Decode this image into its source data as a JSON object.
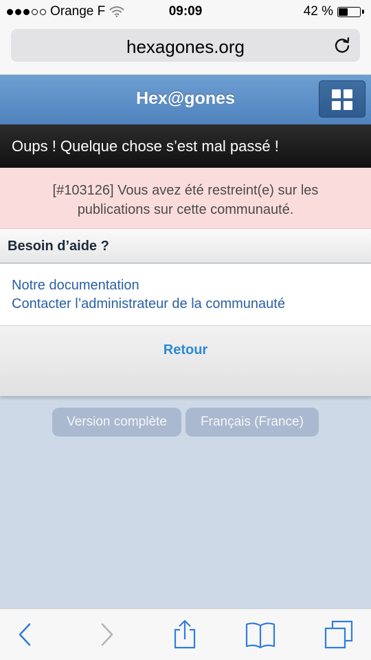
{
  "status": {
    "carrier": "Orange F",
    "time": "09:09",
    "battery_text": "42 %",
    "battery_level": 0.42,
    "signal_bars_filled": 3,
    "signal_bars_total": 5
  },
  "browser": {
    "url": "hexagones.org",
    "reload_icon": "reload-icon"
  },
  "header": {
    "title": "Hex@gones",
    "menu_icon": "grid-icon",
    "accent_color": "#4f83bd"
  },
  "error": {
    "title": "Oups ! Quelque chose s’est mal passé !",
    "message": "[#103126] Vous avez été restreint(e) sur les publications sur cette communauté."
  },
  "help": {
    "title": "Besoin d’aide ?",
    "links": [
      "Notre documentation",
      "Contacter l’administrateur de la communauté"
    ]
  },
  "back_label": "Retour",
  "footer": {
    "version_label": "Version complète",
    "language_label": "Français (France)"
  },
  "toolbar": {
    "icons": [
      "back-icon",
      "forward-icon",
      "share-icon",
      "bookmarks-icon",
      "tabs-icon"
    ]
  }
}
